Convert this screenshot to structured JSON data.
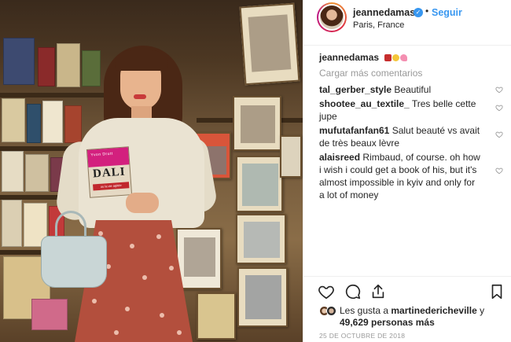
{
  "post": {
    "username": "jeannedamas",
    "follow_label": "Seguir",
    "location": "Paris, France",
    "verified_icon": "✓",
    "dot": "•"
  },
  "caption": {
    "username": "jeannedamas",
    "emoji_colors": [
      "#c62d2d",
      "#f4c63a",
      "#f48fb1"
    ]
  },
  "load_more_label": "Cargar más comentarios",
  "comments": [
    {
      "username": "tal_gerber_style",
      "text": "Beautiful"
    },
    {
      "username": "shootee_au_textile_",
      "text": "Tres belle cette jupe"
    },
    {
      "username": "mufutafanfan61",
      "text": "Salut beauté vs avait de très beaux lèvre"
    },
    {
      "username": "alaisreed",
      "text": "Rimbaud, of course. oh how i wish i could get a book of his, but it's almost impossible in kyiv and only for a lot of money"
    }
  ],
  "likes": {
    "prefix": "Les gusta a",
    "user": "martinedericheville",
    "joiner": "y",
    "count": "49,629 personas más"
  },
  "date": "25 DE OCTUBRE DE 2018",
  "photo_book": {
    "author": "Yvon Drutt",
    "title": "DALI",
    "subtitle": "ou la vie agitée"
  },
  "icons": {
    "like": "heart-icon",
    "comment": "comment-icon",
    "share": "share-icon",
    "save": "bookmark-icon",
    "comment_like": "heart-icon"
  },
  "colors": {
    "link": "#3897f0",
    "text": "#262626",
    "muted": "#999999",
    "border": "#efefef"
  }
}
